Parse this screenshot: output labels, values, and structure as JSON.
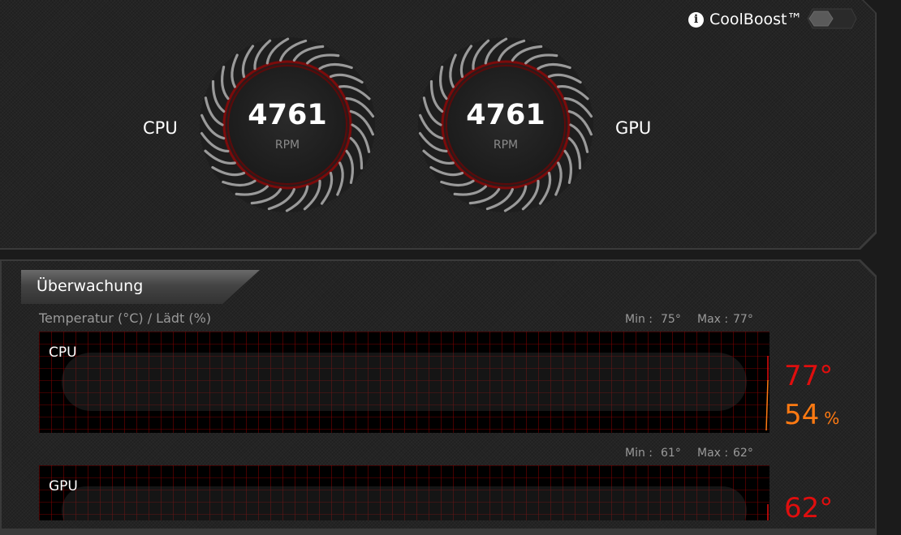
{
  "fans": {
    "cpu": {
      "label": "CPU",
      "rpm": "4761",
      "unit": "RPM"
    },
    "gpu": {
      "label": "GPU",
      "rpm": "4761",
      "unit": "RPM"
    }
  },
  "coolboost": {
    "label": "CoolBoost™",
    "enabled": false
  },
  "monitoring": {
    "tab_label": "Überwachung",
    "section_title": "Temperatur (°C) / Lädt (%)",
    "cpu": {
      "label": "CPU",
      "min_label": "Min :",
      "min": "75°",
      "max_label": "Max :",
      "max": "77°",
      "temperature": "77°",
      "load": "54",
      "load_unit": "%"
    },
    "gpu": {
      "label": "GPU",
      "min_label": "Min :",
      "min": "61°",
      "max_label": "Max :",
      "max": "62°",
      "temperature": "62°"
    }
  },
  "colors": {
    "temperature": "#e00e0e",
    "load": "#ff7a12",
    "accent_red": "#8b0000"
  }
}
